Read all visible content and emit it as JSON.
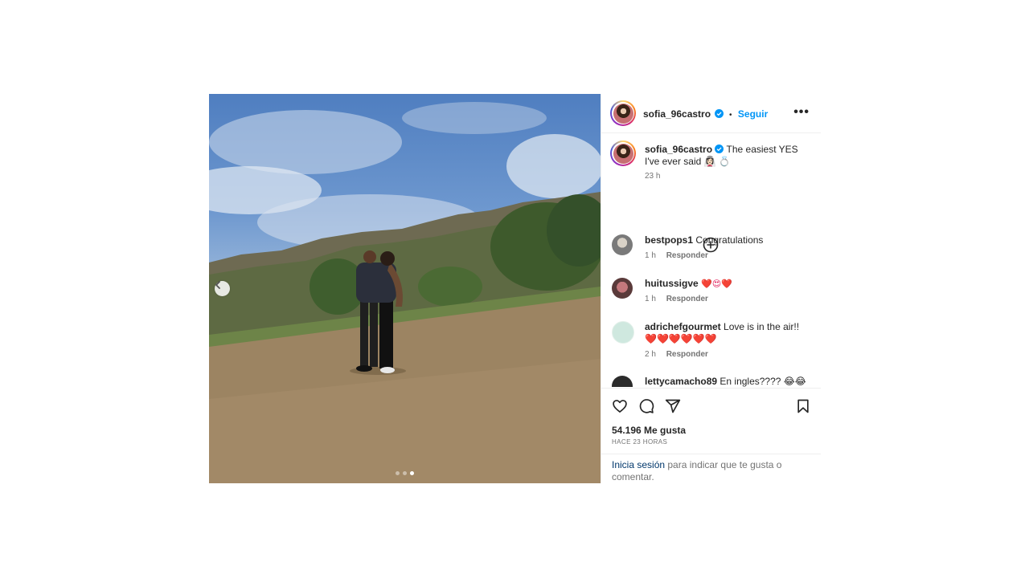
{
  "post": {
    "username": "sofia_96castro",
    "follow_label": "Seguir",
    "separator": "•",
    "more_label": "•••",
    "caption_text": "The easiest YES I've ever said 👰🏻‍♀️ 💍",
    "caption_time": "23 h",
    "likes": "54.196 Me gusta",
    "posted_ago": "HACE 23 HORAS",
    "carousel": {
      "count": 3,
      "active_index": 2
    }
  },
  "comments": [
    {
      "user": "bestpops1",
      "text": "Congratulations",
      "time": "1 h",
      "reply": "Responder",
      "avatar_color": "#8a8a8a"
    },
    {
      "user": "huitussigve",
      "text": "❤️😍❤️",
      "time": "1 h",
      "reply": "Responder",
      "avatar_color": "#a0525a"
    },
    {
      "user": "adrichefgourmet",
      "text": "Love is in the air!!❤️❤️❤️❤️❤️❤️",
      "time": "2 h",
      "reply": "Responder",
      "avatar_color": "#cfe8df"
    },
    {
      "user": "lettycamacho89",
      "text": "En ingles???? 😂😂",
      "time": "",
      "reply": "",
      "avatar_color": "#2b2b2b"
    }
  ],
  "login_prompt": {
    "link": "Inicia sesión",
    "rest": " para indicar que te gusta o comentar."
  },
  "icons": {
    "like": "heart-icon",
    "comment": "comment-icon",
    "share": "share-icon",
    "save": "bookmark-icon",
    "load_more": "plus-circle-icon",
    "prev": "chevron-left-icon",
    "verified": "verified-badge-icon"
  },
  "colors": {
    "accent": "#0095f6",
    "link_dark": "#00376b",
    "text": "#262626",
    "muted": "#737373",
    "verified": "#0095f6"
  }
}
